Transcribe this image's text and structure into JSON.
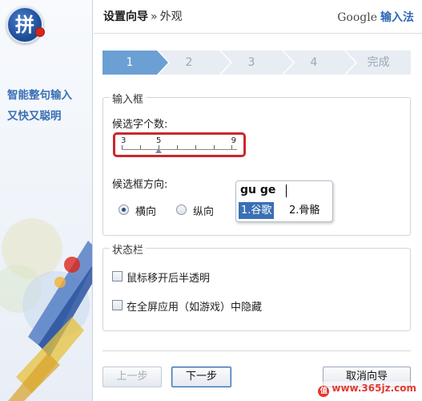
{
  "sidebar": {
    "logo_char": "拼",
    "slogan_line1": "智能整句输入",
    "slogan_line2": "又快又聪明"
  },
  "header": {
    "title": "设置向导",
    "separator": "»",
    "subtitle": "外观",
    "brand_google": "Google",
    "brand_ime": "输入法"
  },
  "steps": [
    "1",
    "2",
    "3",
    "4",
    "完成"
  ],
  "input_box_group": {
    "legend": "输入框",
    "candidate_count_label": "候选字个数:",
    "slider": {
      "min_label": "3",
      "mid_label": "5",
      "max_label": "9",
      "value": 5
    },
    "direction_label": "候选框方向:",
    "horizontal_label": "横向",
    "vertical_label": "纵向",
    "selected_direction": "horizontal",
    "preview": {
      "input_text": "gu ge",
      "candidate1": "1.谷歌",
      "candidate2": "2.骨骼"
    }
  },
  "status_bar_group": {
    "legend": "状态栏",
    "option1": "鼠标移开后半透明",
    "option2": "在全屏应用（如游戏）中隐藏"
  },
  "buttons": {
    "prev": "上一步",
    "next": "下一步",
    "cancel": "取消向导"
  },
  "watermark": "www.365jz.com",
  "colors": {
    "accent": "#6c9fd4",
    "highlight_red": "#c9282b",
    "link_blue": "#3a6fb5"
  }
}
